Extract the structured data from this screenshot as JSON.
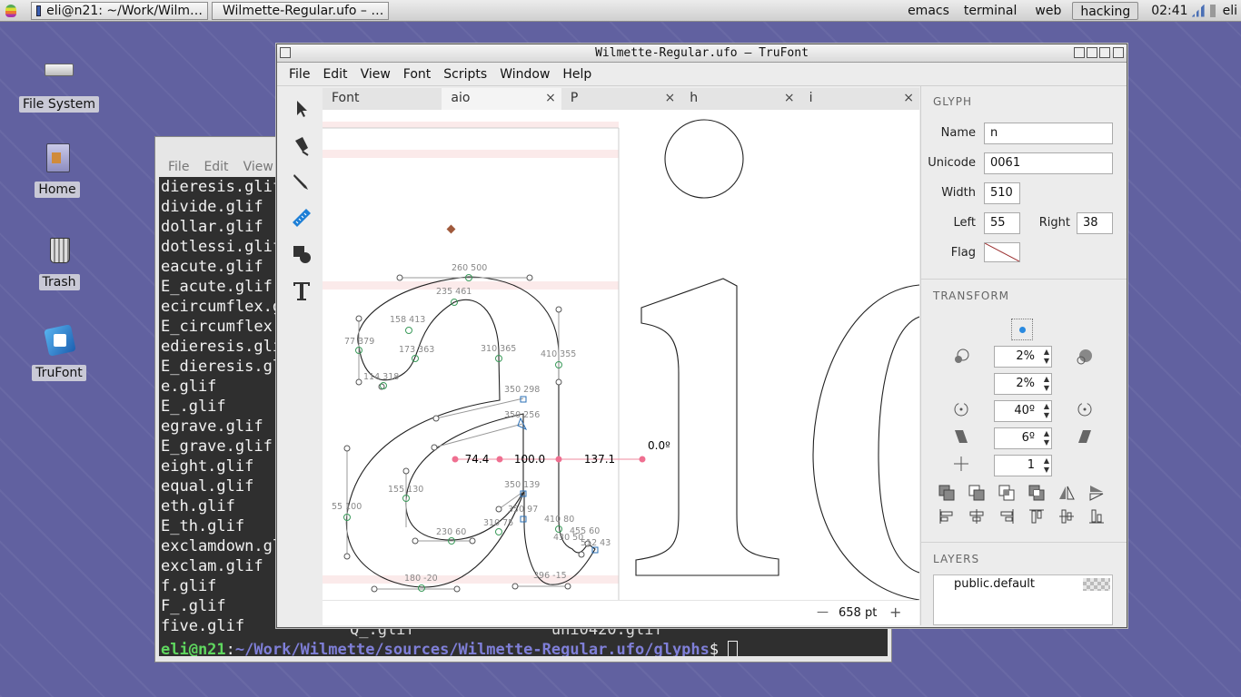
{
  "panel": {
    "tasks": [
      "eli@n21: ~/Work/Wilm…",
      "Wilmette-Regular.ufo – …"
    ],
    "workspaces": [
      "emacs",
      "terminal",
      "web",
      "hacking"
    ],
    "active_workspace": "hacking",
    "time": "02:41",
    "user": "eli"
  },
  "desktop": {
    "icons": [
      "File System",
      "Home",
      "Trash",
      "TruFont"
    ]
  },
  "terminal": {
    "menu": [
      "File",
      "Edit",
      "View"
    ],
    "files": [
      "dieresis.glif",
      "divide.glif",
      "dollar.glif",
      "dotlessi.glif",
      "eacute.glif",
      "E_acute.glif",
      "ecircumflex.glif",
      "E_circumflex.glif",
      "edieresis.glif",
      "E_dieresis.glif",
      "e.glif",
      "E_.glif",
      "egrave.glif",
      "E_grave.glif",
      "eight.glif",
      "equal.glif",
      "eth.glif",
      "E_th.glif",
      "exclamdown.glif",
      "exclam.glif",
      "f.glif",
      "F_.glif",
      "five.glif"
    ],
    "partial_line": [
      "Q_.glif",
      "uni0420.glif"
    ],
    "prompt_user": "eli@n21",
    "prompt_path": "~/Work/Wilmette/sources/Wilmette-Regular.ufo/glyphs",
    "prompt_symbol": "$"
  },
  "window": {
    "title": "Wilmette-Regular.ufo – TruFont",
    "menu": [
      "File",
      "Edit",
      "View",
      "Font",
      "Scripts",
      "Window",
      "Help"
    ],
    "tabs": [
      {
        "label": "Font",
        "closable": false
      },
      {
        "label": "aio",
        "closable": true
      },
      {
        "label": "P",
        "closable": true
      },
      {
        "label": "h",
        "closable": true
      },
      {
        "label": "i",
        "closable": true
      }
    ],
    "active_tab": "aio",
    "zoom": "658 pt",
    "zoom_minus": "—",
    "zoom_plus": "+"
  },
  "canvas": {
    "point_labels": [
      "260  500",
      "235  461",
      "158  413",
      "77  379",
      "173  363",
      "114  318",
      "310  365",
      "410  355",
      "350  298",
      "350  256",
      "155  130",
      "55  100",
      "350  139",
      "350  97",
      "310  75",
      "230  60",
      "410  80",
      "455  60",
      "430  50",
      "512  43",
      "180  -20",
      "396  -15"
    ],
    "measure_labels": [
      "74.4",
      "100.0",
      "137.1",
      "0.0º"
    ]
  },
  "glyph": {
    "section": "GLYPH",
    "name_label": "Name",
    "name": "n",
    "unicode_label": "Unicode",
    "unicode": "0061",
    "width_label": "Width",
    "width": "510",
    "left_label": "Left",
    "left": "55",
    "right_label": "Right",
    "right": "38",
    "flag_label": "Flag"
  },
  "transform": {
    "section": "TRANSFORM",
    "scale_x": "2%",
    "scale_y": "2%",
    "rotate": "40º",
    "skew": "6º",
    "snap": "1"
  },
  "layers": {
    "section": "LAYERS",
    "items": [
      "public.default"
    ]
  }
}
